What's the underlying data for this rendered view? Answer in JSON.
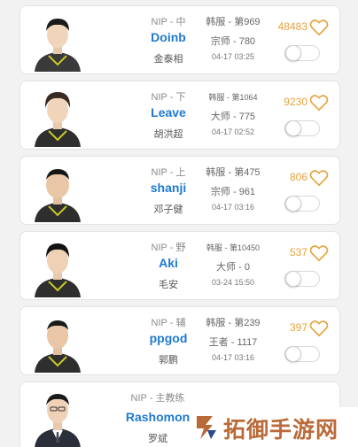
{
  "players": [
    {
      "team_role": "NIP - 中",
      "handle": "Doinb",
      "real_name": "金泰相",
      "server_rank": "韩服 - 第969",
      "tier": "宗师 - 780",
      "time": "04-17 03:25",
      "likes": "48483",
      "jersey_color": "#3a3a3a",
      "accent_color": "#c8c82a"
    },
    {
      "team_role": "NIP - 下",
      "handle": "Leave",
      "real_name": "胡洪超",
      "server_rank": "韩服 - 第1064",
      "tier": "大师 - 775",
      "time": "04-17 02:52",
      "likes": "9230",
      "jersey_color": "#2e2e2e",
      "accent_color": "#c8c82a"
    },
    {
      "team_role": "NIP - 上",
      "handle": "shanji",
      "real_name": "邓子健",
      "server_rank": "韩服 - 第475",
      "tier": "宗师 - 961",
      "time": "04-17 03:16",
      "likes": "806",
      "jersey_color": "#2e2e2e",
      "accent_color": "#c8c82a"
    },
    {
      "team_role": "NIP - 野",
      "handle": "Aki",
      "real_name": "毛安",
      "server_rank": "韩服 - 第10450",
      "tier": "大师 - 0",
      "time": "03-24 15:50",
      "likes": "537",
      "jersey_color": "#2e2e2e",
      "accent_color": "#c8c82a"
    },
    {
      "team_role": "NIP - 辅",
      "handle": "ppgod",
      "real_name": "郭鹏",
      "server_rank": "韩服 - 第239",
      "tier": "王者 - 1117",
      "time": "04-17 03:16",
      "likes": "397",
      "jersey_color": "#2e2e2e",
      "accent_color": "#c8c82a"
    },
    {
      "team_role": "NIP - 主教练",
      "handle": "Rashomon",
      "real_name": "罗斌",
      "jersey_color": "#2a2f3a",
      "accent_color": "#d0d0d0"
    }
  ],
  "watermark": {
    "text": "拓御手游网",
    "color": "#b96a38"
  },
  "colors": {
    "handle": "#1f79d1",
    "likes": "#e6a23c"
  }
}
